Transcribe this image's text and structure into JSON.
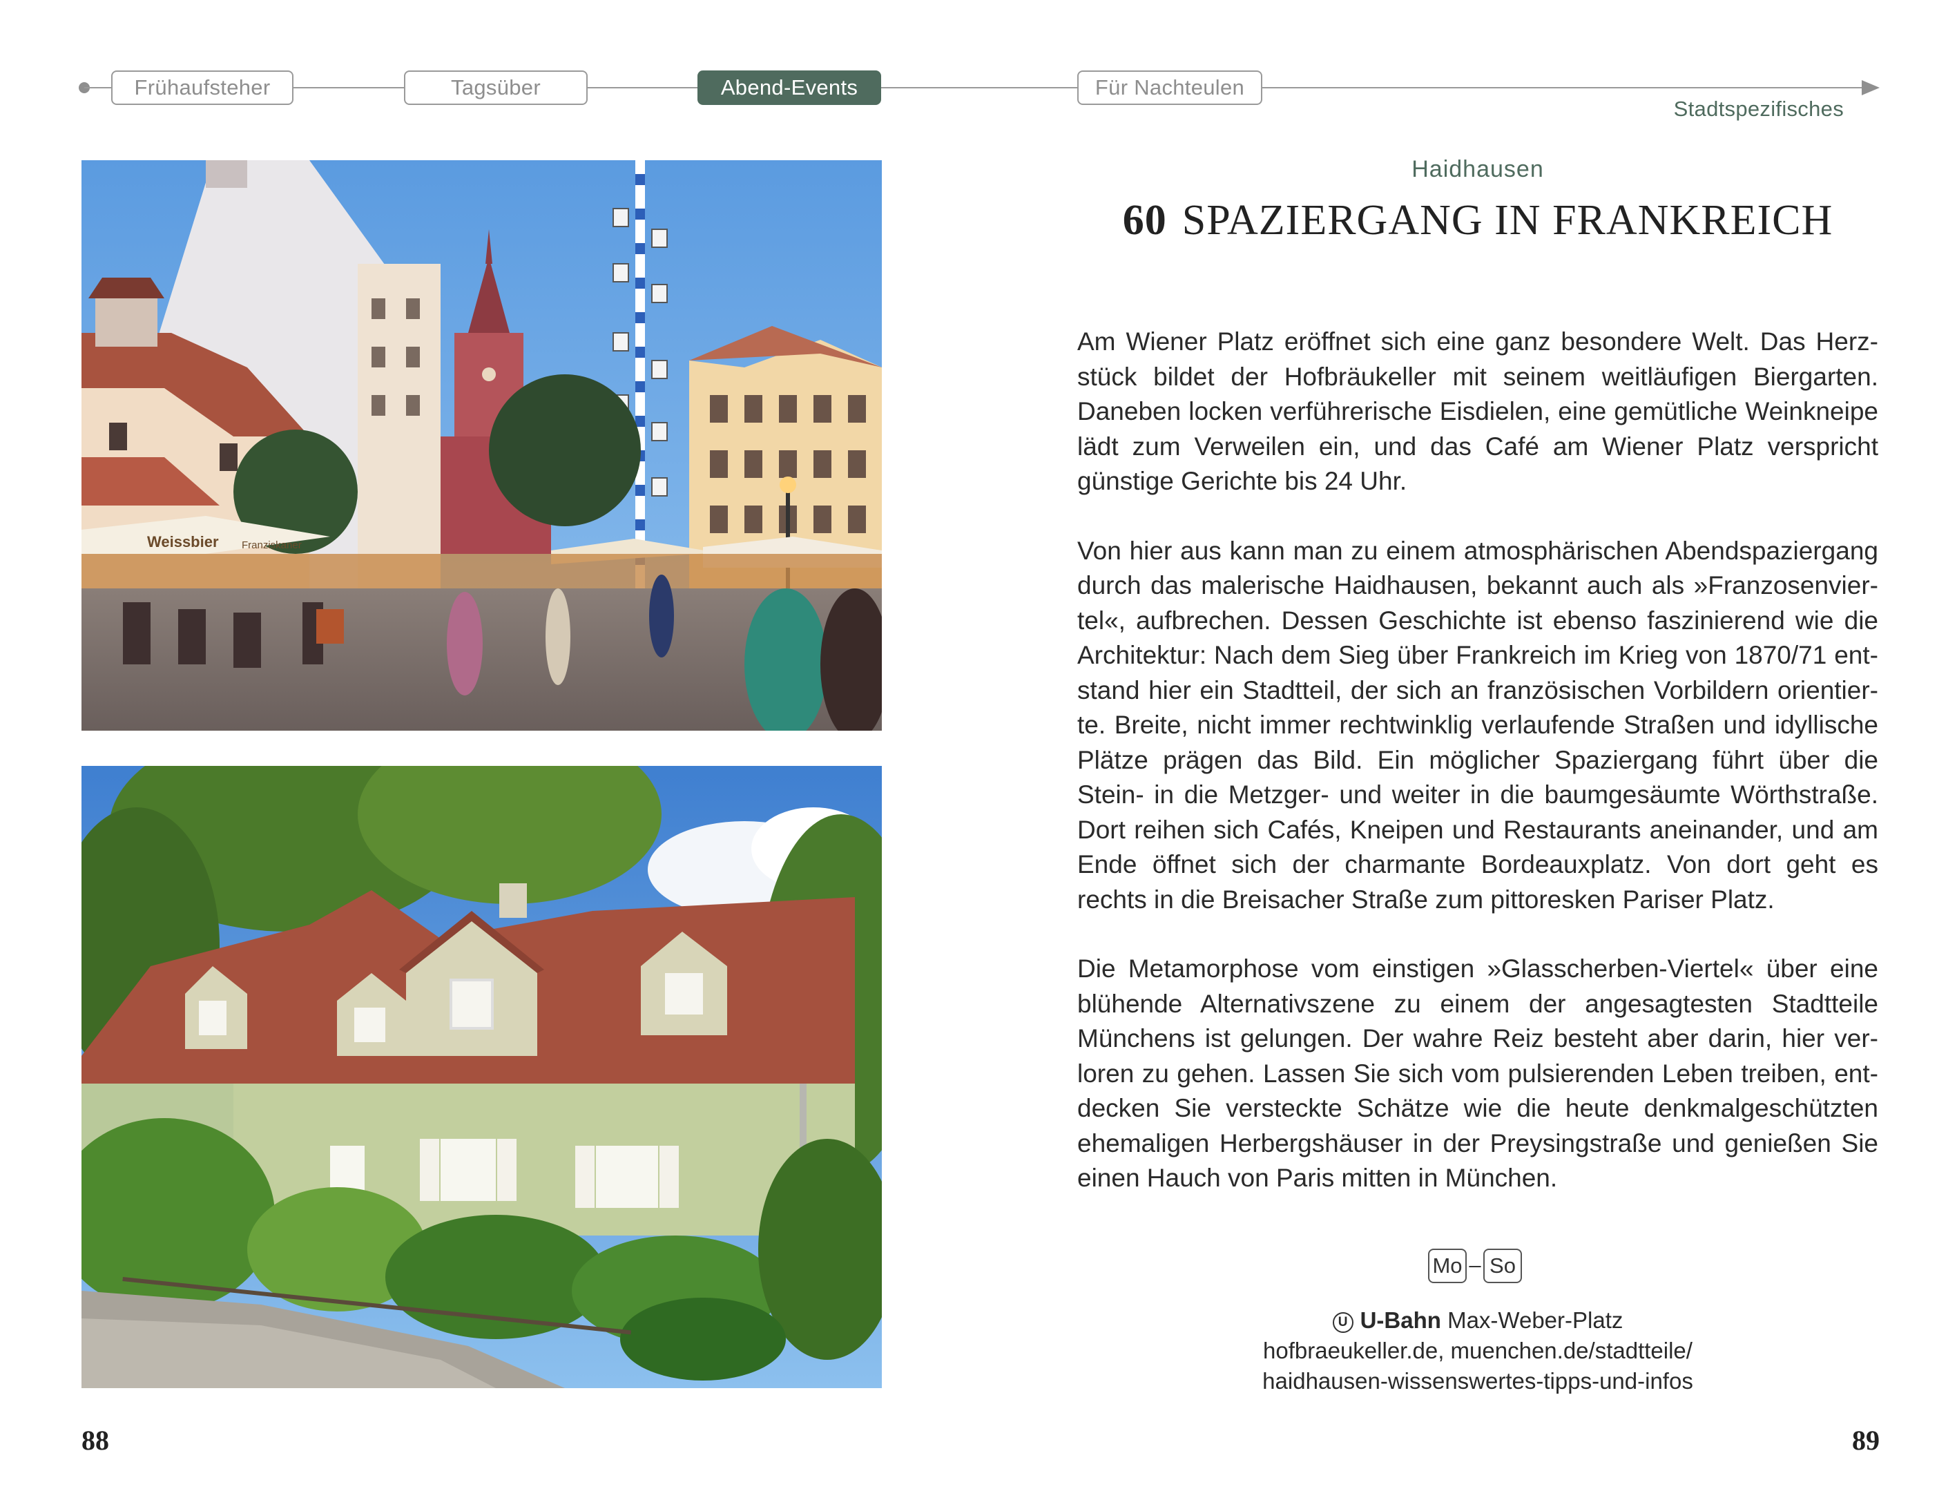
{
  "timeline": {
    "tabs": [
      {
        "label": "Frühaufsteher"
      },
      {
        "label": "Tagsüber"
      },
      {
        "label": "Abend-Events"
      },
      {
        "label": "Für Nachteulen"
      }
    ],
    "active_tab": "Abend-Events",
    "section_label": "Stadtspezifisches"
  },
  "article": {
    "district": "Haidhausen",
    "number": "60",
    "title": "SPAZIERGANG IN FRANKREICH",
    "paragraphs": [
      "Am Wiener Platz eröffnet sich eine ganz besondere Welt. Das Herz­stück bildet der Hofbräukeller mit seinem weitläufigen Biergarten. Daneben locken verführerische Eisdielen, eine gemütliche Weinknei­pe lädt zum Verweilen ein, und das Café am Wiener Platz verspricht günstige Gerichte bis 24 Uhr.",
      "Von hier aus kann man zu einem atmosphärischen Abendspaziergang durch das malerische Haidhausen, bekannt auch als »Franzosenvier­tel«, aufbrechen. Dessen Geschichte ist ebenso faszinierend wie die Architektur: Nach dem Sieg über Frankreich im Krieg von 1870/71 ent­stand hier ein Stadtteil, der sich an französischen Vorbildern orientier­te. Breite, nicht immer rechtwinklig verlaufende Straßen und idyllische Plätze prägen das Bild. Ein möglicher Spaziergang führt über die Stein- in die Metzger- und weiter in die baumgesäumte Wörthstraße. Dort reihen sich Cafés, Kneipen und Restaurants aneinander, und am Ende öffnet sich der charmante Bordeauxplatz. Von dort geht es rechts in die Breisacher Straße zum pittoresken Pariser Platz.",
      "Die Metamorphose vom einstigen »Glasscherben-Viertel« über eine blühende Alternativszene zu einem der angesagtesten Stadtteile Münchens ist gelungen. Der wahre Reiz besteht aber darin, hier ver­loren zu gehen. Lassen Sie sich vom pulsierenden Leben treiben, ent­decken Sie versteckte Schätze wie die heute denkmalgeschützten ehemaligen Herbergshäuser in der Preysingstraße und genießen Sie einen Hauch von Paris mitten in München."
    ],
    "days": {
      "from": "Mo",
      "separator": "–",
      "to": "So"
    },
    "transit": {
      "icon": "u-bahn-icon",
      "icon_glyph": "U",
      "type": "U-Bahn",
      "stop": "Max-Weber-Platz"
    },
    "links": [
      "hofbraeukeller.de, muenchen.de/stadtteile/",
      "haidhausen-wissenswertes-tipps-und-infos"
    ]
  },
  "photos": {
    "top": {
      "umbrella_text": "Weissbier",
      "umbrella_brand": "Franziskaner"
    }
  },
  "pages": {
    "left": "88",
    "right": "89"
  }
}
